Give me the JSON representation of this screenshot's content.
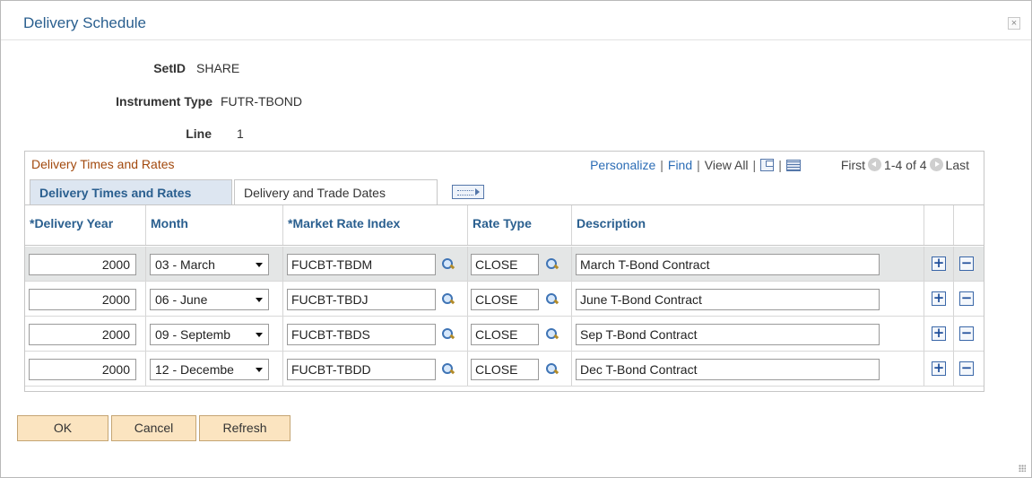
{
  "modal": {
    "title": "Delivery Schedule",
    "close_symbol": "×"
  },
  "fields": {
    "setid": {
      "label": "SetID",
      "value": "SHARE"
    },
    "instrument_type": {
      "label": "Instrument Type",
      "value": "FUTR-TBOND"
    },
    "line": {
      "label": "Line",
      "value": "1"
    }
  },
  "grid": {
    "title": "Delivery Times and Rates",
    "nav": {
      "personalize": "Personalize",
      "find": "Find",
      "view_all": "View All",
      "sep": "|",
      "first": "First",
      "range": "1-4 of 4",
      "last": "Last"
    },
    "tabs": [
      {
        "label": "Delivery Times and Rates",
        "active": true
      },
      {
        "label": "Delivery and Trade Dates",
        "active": false
      }
    ],
    "columns": {
      "delivery_year": "*Delivery Year",
      "month": "Month",
      "market_rate_index": "*Market Rate Index",
      "rate_type": "Rate Type",
      "description": "Description"
    },
    "rows": [
      {
        "year": "2000",
        "month": "03 - March",
        "index": "FUCBT-TBDM",
        "rate_type": "CLOSE",
        "description": "March T-Bond Contract"
      },
      {
        "year": "2000",
        "month": "06 - June",
        "index": "FUCBT-TBDJ",
        "rate_type": "CLOSE",
        "description": "June T-Bond Contract"
      },
      {
        "year": "2000",
        "month": "09 - Septemb",
        "index": "FUCBT-TBDS",
        "rate_type": "CLOSE",
        "description": "Sep T-Bond Contract"
      },
      {
        "year": "2000",
        "month": "12 - Decembe",
        "index": "FUCBT-TBDD",
        "rate_type": "CLOSE",
        "description": "Dec T-Bond Contract"
      }
    ],
    "add_symbol": "+",
    "remove_symbol": "−"
  },
  "buttons": {
    "ok": "OK",
    "cancel": "Cancel",
    "refresh": "Refresh"
  },
  "colors": {
    "title_blue": "#2a5f8f",
    "grid_title_orange": "#a2490d",
    "link_blue": "#2b6cb5",
    "button_fill": "#fbe4c0",
    "row_highlight": "#e4e6e6"
  }
}
